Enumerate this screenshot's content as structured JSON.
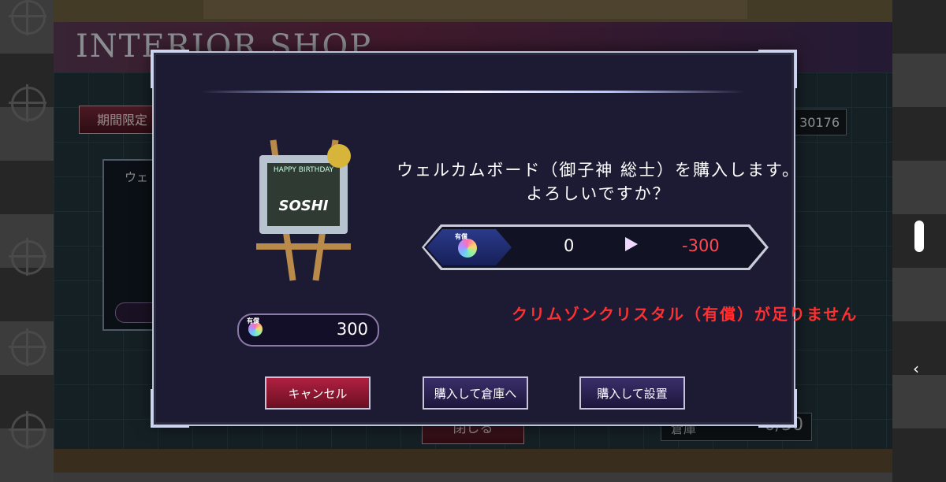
{
  "background": {
    "shop_title": "INTERIOR SHOP",
    "limited_tab_label": "期間限定",
    "currency_value": "30176",
    "item_panel_label": "ウェ",
    "close_button_label": "閉じる",
    "storage_label": "倉庫",
    "storage_count": "0/50"
  },
  "dialog": {
    "item_image": {
      "board_line1": "HAPPY BIRTHDAY",
      "board_line2": "SOSHI"
    },
    "price": "300",
    "gem_tag": "有償",
    "message_line1": "ウェルカムボード（御子神 総士）を購入します。",
    "message_line2": "よろしいですか？",
    "exchange": {
      "gem_tag": "有償",
      "current": "0",
      "after": "-300"
    },
    "warning": "クリムゾンクリスタル（有償）が足りません",
    "buttons": {
      "cancel": "キャンセル",
      "buy_store": "購入して倉庫へ",
      "buy_place": "購入して設置"
    }
  },
  "colors": {
    "modal_bg": "#1c1b33",
    "warning": "#ff3030",
    "negative": "#ff4a55",
    "cancel_button": "#b02040"
  },
  "android_nav": {
    "back_icon": "chevron-left-icon"
  }
}
